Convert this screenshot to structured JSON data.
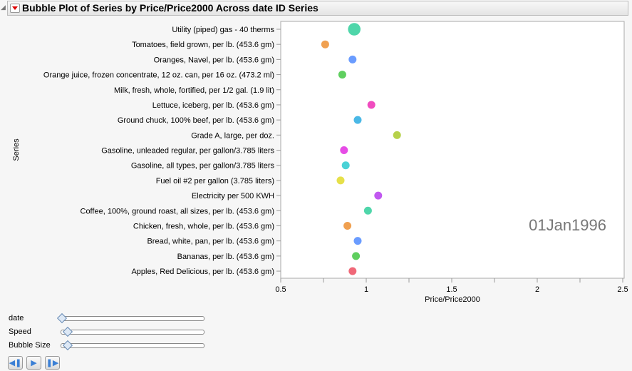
{
  "header": {
    "title": "Bubble Plot of Series by Price/Price2000 Across date ID Series"
  },
  "chart_data": {
    "type": "scatter",
    "title": "Bubble Plot of Series by Price/Price2000 Across date ID Series",
    "xlabel": "Price/Price2000",
    "ylabel": "Series",
    "xlim": [
      0.5,
      2.5
    ],
    "xticks": [
      "0.5",
      "1",
      "1.5",
      "2",
      "2.5"
    ],
    "frame_label": "01Jan1996",
    "categories": [
      "Utility (piped) gas - 40 therms",
      "Tomatoes, field grown, per lb. (453.6 gm)",
      "Oranges, Navel, per lb. (453.6 gm)",
      "Orange juice, frozen concentrate, 12 oz. can, per 16 oz. (473.2 ml)",
      "Milk, fresh, whole, fortified, per 1/2 gal. (1.9 lit)",
      "Lettuce, iceberg, per lb. (453.6 gm)",
      "Ground chuck, 100% beef, per lb. (453.6 gm)",
      "Grade A, large, per doz.",
      "Gasoline, unleaded regular, per gallon/3.785 liters",
      "Gasoline, all types, per gallon/3.785 liters",
      "Fuel oil #2 per gallon (3.785 liters)",
      "Electricity per 500 KWH",
      "Coffee, 100%, ground roast, all sizes, per lb. (453.6 gm)",
      "Chicken, fresh, whole, per lb. (453.6 gm)",
      "Bread, white, pan, per lb. (453.6 gm)",
      "Bananas, per lb. (453.6 gm)",
      "Apples, Red Delicious, per lb. (453.6 gm)"
    ],
    "values": [
      0.93,
      0.76,
      0.92,
      0.86,
      null,
      1.03,
      0.95,
      1.18,
      0.87,
      0.88,
      0.85,
      1.07,
      1.01,
      0.89,
      0.95,
      0.94,
      0.92
    ],
    "sizes": [
      1.6,
      1,
      1,
      1,
      0,
      1,
      1,
      1,
      1,
      1,
      1,
      1,
      1,
      1,
      1,
      1,
      1
    ],
    "colors": [
      "#4fd6aa",
      "#f0a050",
      "#6a9cff",
      "#5fcf5f",
      "#cccccc",
      "#f04cbf",
      "#4ab8e6",
      "#b6d14a",
      "#e64ce6",
      "#4ad2d6",
      "#e6e04a",
      "#c158f0",
      "#4fd6aa",
      "#f0a050",
      "#6a9cff",
      "#5fcf5f",
      "#f06878"
    ]
  },
  "controls": {
    "date_label": "date",
    "speed_label": "Speed",
    "bubble_size_label": "Bubble Size",
    "date_pos": 0,
    "speed_pos": 0.04,
    "bubble_size_pos": 0.04
  }
}
